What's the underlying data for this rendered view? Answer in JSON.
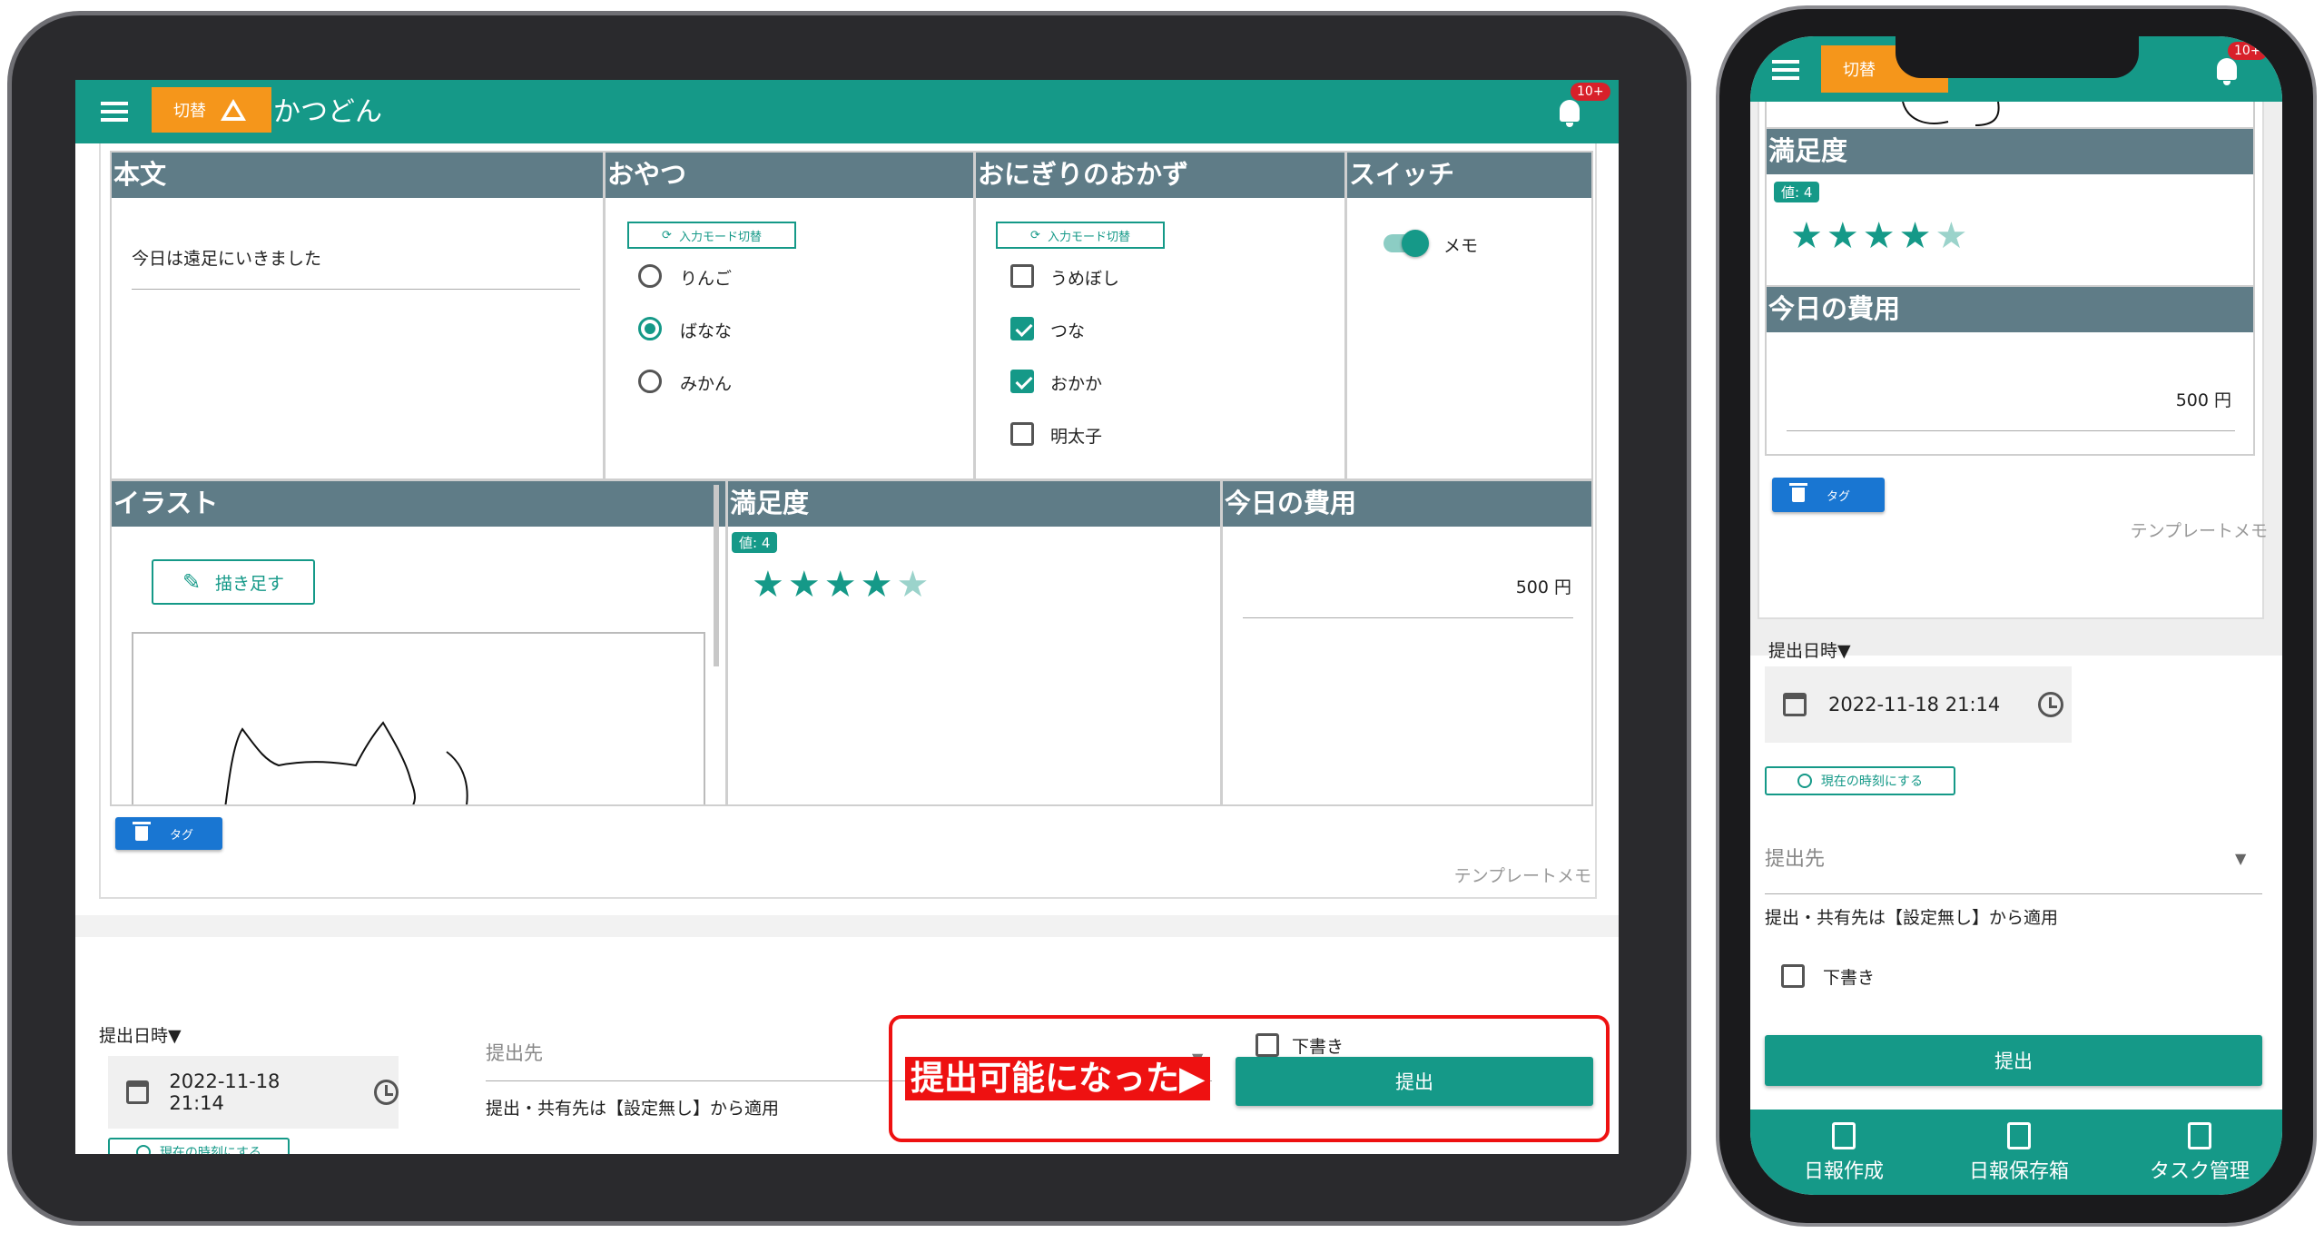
{
  "app": {
    "title": "かつどん",
    "switch_label": "切替",
    "notification_count": "10+",
    "accent_color": "#159988",
    "header_color": "#5f7c87",
    "switch_color": "#f5961b"
  },
  "form": {
    "honbun": {
      "header": "本文",
      "text": "今日は遠足にいきました"
    },
    "oyatsu": {
      "header": "おやつ",
      "mode_button": "入力モード切替",
      "options": [
        "りんご",
        "ばなな",
        "みかん"
      ],
      "selected": "ばなな"
    },
    "onigiri": {
      "header": "おにぎりのおかず",
      "mode_button": "入力モード切替",
      "options": [
        {
          "label": "うめぼし",
          "checked": false
        },
        {
          "label": "つな",
          "checked": true
        },
        {
          "label": "おかか",
          "checked": true
        },
        {
          "label": "明太子",
          "checked": false
        }
      ]
    },
    "switch": {
      "header": "スイッチ",
      "label": "メモ",
      "on": true
    },
    "illust": {
      "header": "イラスト",
      "draw_button": "描き足す"
    },
    "manzokudo": {
      "header": "満足度",
      "value_badge": "値: 4",
      "rating": 4,
      "max": 5
    },
    "hiyou": {
      "header": "今日の費用",
      "value": "500 円"
    },
    "tag_button": "タグ",
    "template_memo": "テンプレートメモ"
  },
  "submit_area": {
    "date_label": "提出日時▼",
    "datetime": "2022-11-18 21:14",
    "now_button": "現在の時刻にする",
    "destination_placeholder": "提出先",
    "share_note": "提出・共有先は【設定無し】から適用",
    "draft_label": "下書き",
    "submit_button": "提出",
    "annotation": "提出可能になった▶"
  },
  "bottom_nav": {
    "items": [
      "日報作成",
      "日報保存箱",
      "タスク管理"
    ]
  }
}
